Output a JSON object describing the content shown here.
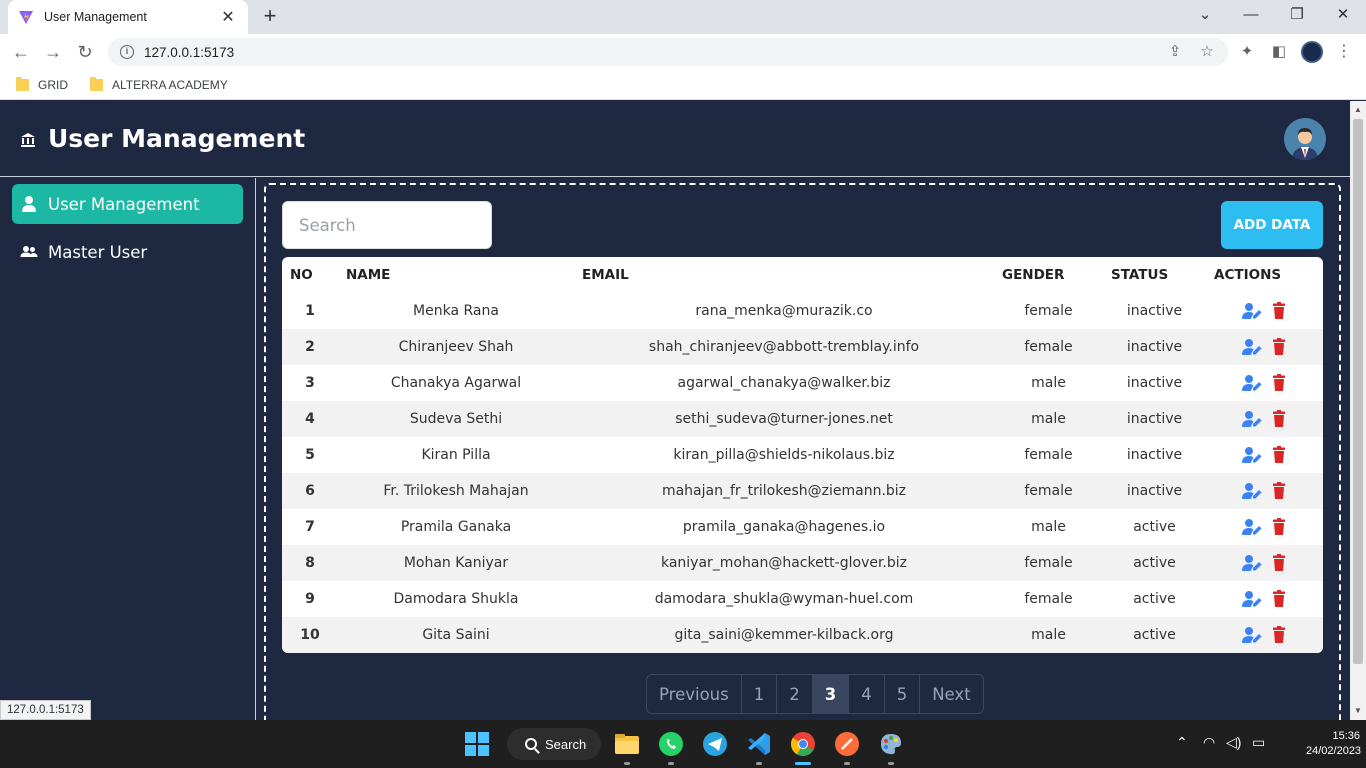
{
  "browser": {
    "tab_title": "User Management",
    "url": "127.0.0.1:5173",
    "bookmarks": [
      "GRID",
      "ALTERRA ACADEMY"
    ],
    "status_url": "127.0.0.1:5173"
  },
  "app": {
    "title": "User Management",
    "sidebar": {
      "items": [
        {
          "label": "User Management",
          "active": true
        },
        {
          "label": "Master User",
          "active": false
        }
      ]
    },
    "search": {
      "placeholder": "Search",
      "value": ""
    },
    "add_button_label": "ADD DATA",
    "table": {
      "headers": [
        "NO",
        "NAME",
        "EMAIL",
        "GENDER",
        "STATUS",
        "ACTIONS"
      ],
      "rows": [
        {
          "no": "1",
          "name": "Menka Rana",
          "email": "rana_menka@murazik.co",
          "gender": "female",
          "status": "inactive"
        },
        {
          "no": "2",
          "name": "Chiranjeev Shah",
          "email": "shah_chiranjeev@abbott-tremblay.info",
          "gender": "female",
          "status": "inactive"
        },
        {
          "no": "3",
          "name": "Chanakya Agarwal",
          "email": "agarwal_chanakya@walker.biz",
          "gender": "male",
          "status": "inactive"
        },
        {
          "no": "4",
          "name": "Sudeva Sethi",
          "email": "sethi_sudeva@turner-jones.net",
          "gender": "male",
          "status": "inactive"
        },
        {
          "no": "5",
          "name": "Kiran Pilla",
          "email": "kiran_pilla@shields-nikolaus.biz",
          "gender": "female",
          "status": "inactive"
        },
        {
          "no": "6",
          "name": "Fr. Trilokesh Mahajan",
          "email": "mahajan_fr_trilokesh@ziemann.biz",
          "gender": "female",
          "status": "inactive"
        },
        {
          "no": "7",
          "name": "Pramila Ganaka",
          "email": "pramila_ganaka@hagenes.io",
          "gender": "male",
          "status": "active"
        },
        {
          "no": "8",
          "name": "Mohan Kaniyar",
          "email": "kaniyar_mohan@hackett-glover.biz",
          "gender": "female",
          "status": "active"
        },
        {
          "no": "9",
          "name": "Damodara Shukla",
          "email": "damodara_shukla@wyman-huel.com",
          "gender": "female",
          "status": "active"
        },
        {
          "no": "10",
          "name": "Gita Saini",
          "email": "gita_saini@kemmer-kilback.org",
          "gender": "male",
          "status": "active"
        }
      ],
      "edit_icon": "user-edit-icon",
      "delete_icon": "trash-icon",
      "edit_color": "#3b82f6",
      "delete_color": "#dc2626"
    },
    "pagination": {
      "previous": "Previous",
      "pages": [
        "1",
        "2",
        "3",
        "4",
        "5"
      ],
      "current": "3",
      "next": "Next"
    }
  },
  "taskbar": {
    "search_label": "Search",
    "time": "15:36",
    "date": "24/02/2023"
  },
  "colors": {
    "app_bg": "#1e2840",
    "sidebar_active": "#1cb8a4",
    "add_button": "#2ebdf0"
  }
}
